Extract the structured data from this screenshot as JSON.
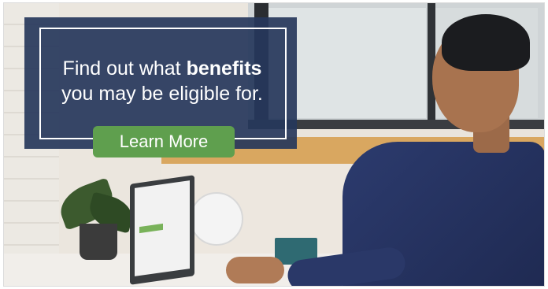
{
  "banner": {
    "headline_part1": "Find out what ",
    "headline_bold": "benefits",
    "headline_part2": "you may be eligible for.",
    "cta_label": "Learn More"
  },
  "colors": {
    "overlay": "#26375b",
    "cta": "#5f9f4e",
    "text": "#ffffff"
  }
}
